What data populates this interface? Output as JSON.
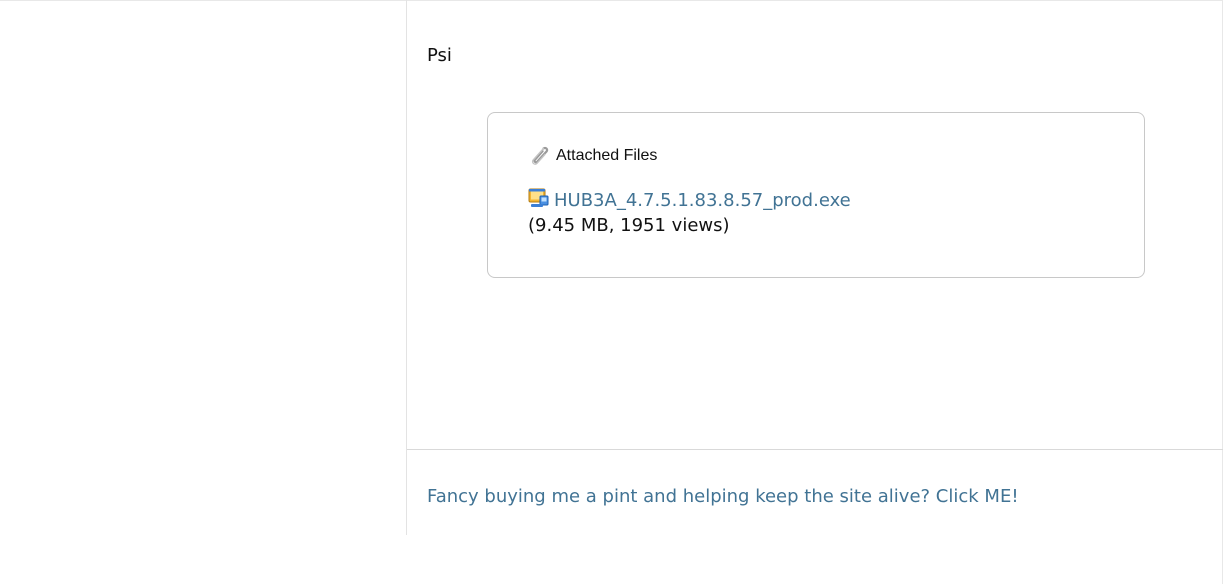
{
  "post": {
    "text": "Psi"
  },
  "attachments": {
    "title": "Attached Files",
    "header_icon": "paperclip-icon",
    "file": {
      "icon": "exe-file-icon",
      "name": "HUB3A_4.7.5.1.83.8.57_prod.exe",
      "meta": "(9.45 MB, 1951 views)"
    }
  },
  "signature": {
    "link_text": "Fancy buying me a pint and helping keep the site alive? Click ME!"
  },
  "colors": {
    "link": "#417394",
    "border": "#c8c8c8",
    "divider": "#d9d9d9"
  }
}
